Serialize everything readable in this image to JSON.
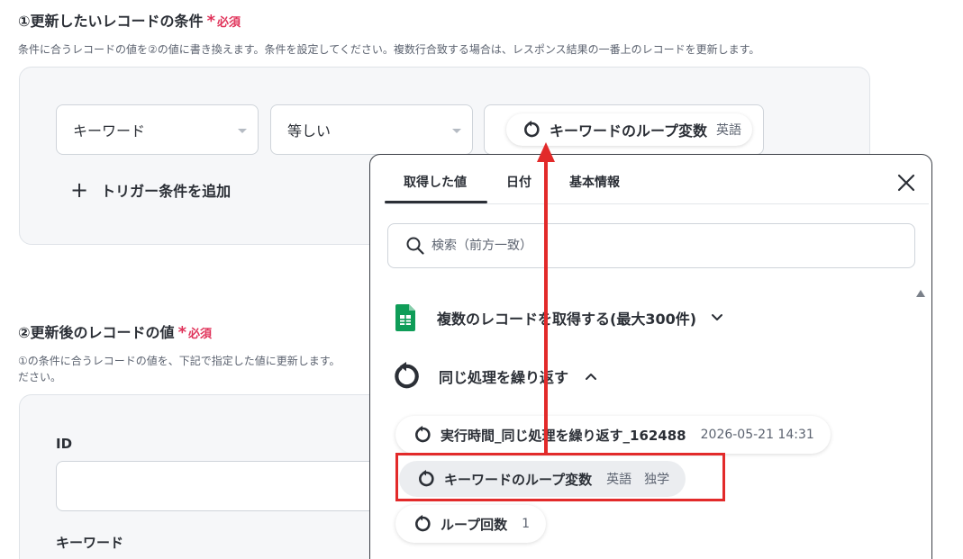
{
  "section1": {
    "title": "①更新したいレコードの条件",
    "required_star": "*",
    "required_label": "必須",
    "description": "条件に合うレコードの値を②の値に書き換えます。条件を設定してください。複数行合致する場合は、レスポンス結果の一番上のレコードを更新します。",
    "field_select": "キーワード",
    "operator_select": "等しい",
    "value_chip_label": "キーワードのループ変数",
    "value_chip_value": "英語",
    "add_condition_plus": "+",
    "add_condition_label": "トリガー条件を追加"
  },
  "section2": {
    "title": "②更新後のレコードの値",
    "required_star": "*",
    "required_label": "必須",
    "description_line1": "①の条件に合うレコードの値を、下記で指定した値に更新します。",
    "description_line2": "ださい。",
    "field_id_label": "ID",
    "field_keyword_label": "キーワード"
  },
  "popup": {
    "tabs": [
      {
        "label": "取得した値",
        "active": true
      },
      {
        "label": "日付",
        "active": false
      },
      {
        "label": "基本情報",
        "active": false
      }
    ],
    "search_placeholder": "検索（前方一致）",
    "groups": [
      {
        "label": "複数のレコードを取得する(最大300件)",
        "icon": "google-sheets-icon",
        "expanded": false
      },
      {
        "label": "同じ処理を繰り返す",
        "icon": "loop-icon",
        "expanded": true
      }
    ],
    "items": [
      {
        "label": "実行時間_同じ処理を繰り返す_162488",
        "value": "2026-05-21 14:31",
        "value2": ""
      },
      {
        "label": "キーワードのループ変数",
        "value": "英語",
        "value2": "独学"
      },
      {
        "label": "ループ回数",
        "value": "1",
        "value2": ""
      }
    ]
  },
  "colors": {
    "required": "#e0335a",
    "highlight": "#e22a2a",
    "sheets_green": "#0f9d58"
  }
}
